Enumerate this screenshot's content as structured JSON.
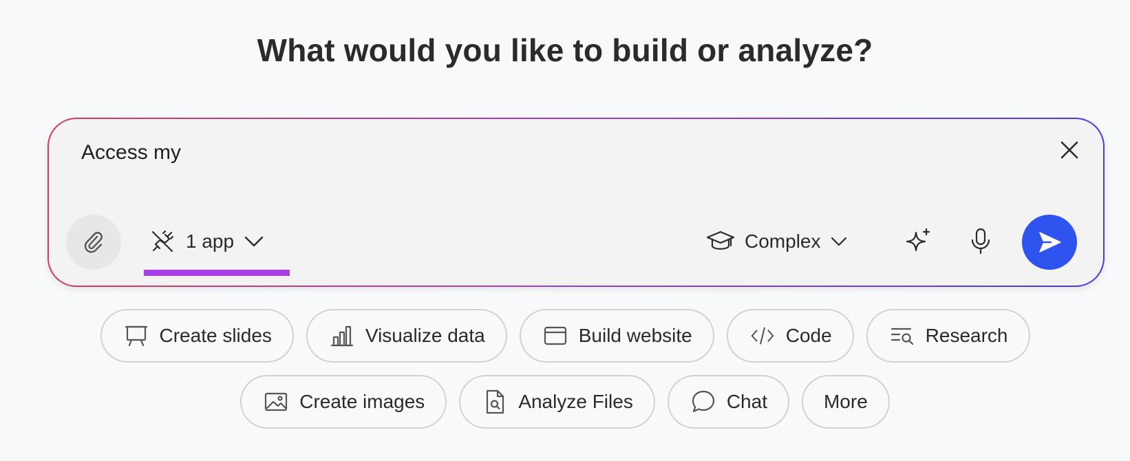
{
  "heading": "What would you like to build or analyze?",
  "composer": {
    "prompt_value": "Access my",
    "apps_label": "1 app",
    "mode_label": "Complex",
    "accent_gradient": [
      "#cf3d5a",
      "#a33fb8",
      "#4b3ae0"
    ],
    "underline_color": "#a83ee6",
    "send_color": "#2e53ee"
  },
  "suggestions": {
    "row1": [
      {
        "label": "Create slides",
        "icon": "presentation-icon"
      },
      {
        "label": "Visualize data",
        "icon": "bar-chart-icon"
      },
      {
        "label": "Build website",
        "icon": "browser-window-icon"
      },
      {
        "label": "Code",
        "icon": "code-icon"
      },
      {
        "label": "Research",
        "icon": "research-icon"
      }
    ],
    "row2": [
      {
        "label": "Create images",
        "icon": "image-icon"
      },
      {
        "label": "Analyze Files",
        "icon": "file-search-icon"
      },
      {
        "label": "Chat",
        "icon": "chat-bubble-icon"
      },
      {
        "label": "More",
        "icon": ""
      }
    ]
  }
}
